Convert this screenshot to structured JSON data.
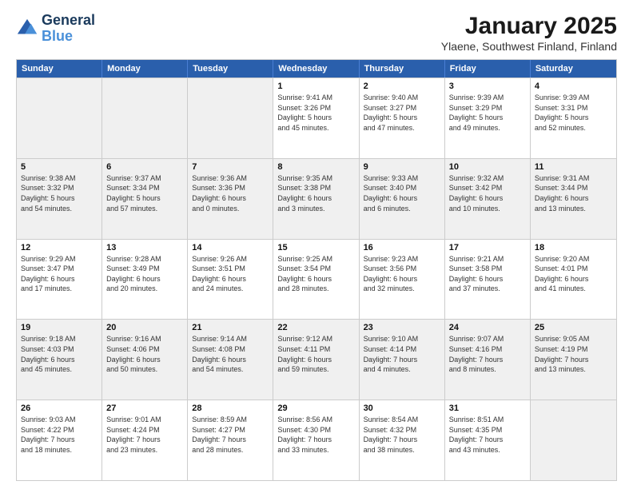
{
  "logo": {
    "line1": "General",
    "line2": "Blue"
  },
  "title": "January 2025",
  "subtitle": "Ylaene, Southwest Finland, Finland",
  "days": [
    "Sunday",
    "Monday",
    "Tuesday",
    "Wednesday",
    "Thursday",
    "Friday",
    "Saturday"
  ],
  "weeks": [
    [
      {
        "num": "",
        "info": ""
      },
      {
        "num": "",
        "info": ""
      },
      {
        "num": "",
        "info": ""
      },
      {
        "num": "1",
        "info": "Sunrise: 9:41 AM\nSunset: 3:26 PM\nDaylight: 5 hours\nand 45 minutes."
      },
      {
        "num": "2",
        "info": "Sunrise: 9:40 AM\nSunset: 3:27 PM\nDaylight: 5 hours\nand 47 minutes."
      },
      {
        "num": "3",
        "info": "Sunrise: 9:39 AM\nSunset: 3:29 PM\nDaylight: 5 hours\nand 49 minutes."
      },
      {
        "num": "4",
        "info": "Sunrise: 9:39 AM\nSunset: 3:31 PM\nDaylight: 5 hours\nand 52 minutes."
      }
    ],
    [
      {
        "num": "5",
        "info": "Sunrise: 9:38 AM\nSunset: 3:32 PM\nDaylight: 5 hours\nand 54 minutes."
      },
      {
        "num": "6",
        "info": "Sunrise: 9:37 AM\nSunset: 3:34 PM\nDaylight: 5 hours\nand 57 minutes."
      },
      {
        "num": "7",
        "info": "Sunrise: 9:36 AM\nSunset: 3:36 PM\nDaylight: 6 hours\nand 0 minutes."
      },
      {
        "num": "8",
        "info": "Sunrise: 9:35 AM\nSunset: 3:38 PM\nDaylight: 6 hours\nand 3 minutes."
      },
      {
        "num": "9",
        "info": "Sunrise: 9:33 AM\nSunset: 3:40 PM\nDaylight: 6 hours\nand 6 minutes."
      },
      {
        "num": "10",
        "info": "Sunrise: 9:32 AM\nSunset: 3:42 PM\nDaylight: 6 hours\nand 10 minutes."
      },
      {
        "num": "11",
        "info": "Sunrise: 9:31 AM\nSunset: 3:44 PM\nDaylight: 6 hours\nand 13 minutes."
      }
    ],
    [
      {
        "num": "12",
        "info": "Sunrise: 9:29 AM\nSunset: 3:47 PM\nDaylight: 6 hours\nand 17 minutes."
      },
      {
        "num": "13",
        "info": "Sunrise: 9:28 AM\nSunset: 3:49 PM\nDaylight: 6 hours\nand 20 minutes."
      },
      {
        "num": "14",
        "info": "Sunrise: 9:26 AM\nSunset: 3:51 PM\nDaylight: 6 hours\nand 24 minutes."
      },
      {
        "num": "15",
        "info": "Sunrise: 9:25 AM\nSunset: 3:54 PM\nDaylight: 6 hours\nand 28 minutes."
      },
      {
        "num": "16",
        "info": "Sunrise: 9:23 AM\nSunset: 3:56 PM\nDaylight: 6 hours\nand 32 minutes."
      },
      {
        "num": "17",
        "info": "Sunrise: 9:21 AM\nSunset: 3:58 PM\nDaylight: 6 hours\nand 37 minutes."
      },
      {
        "num": "18",
        "info": "Sunrise: 9:20 AM\nSunset: 4:01 PM\nDaylight: 6 hours\nand 41 minutes."
      }
    ],
    [
      {
        "num": "19",
        "info": "Sunrise: 9:18 AM\nSunset: 4:03 PM\nDaylight: 6 hours\nand 45 minutes."
      },
      {
        "num": "20",
        "info": "Sunrise: 9:16 AM\nSunset: 4:06 PM\nDaylight: 6 hours\nand 50 minutes."
      },
      {
        "num": "21",
        "info": "Sunrise: 9:14 AM\nSunset: 4:08 PM\nDaylight: 6 hours\nand 54 minutes."
      },
      {
        "num": "22",
        "info": "Sunrise: 9:12 AM\nSunset: 4:11 PM\nDaylight: 6 hours\nand 59 minutes."
      },
      {
        "num": "23",
        "info": "Sunrise: 9:10 AM\nSunset: 4:14 PM\nDaylight: 7 hours\nand 4 minutes."
      },
      {
        "num": "24",
        "info": "Sunrise: 9:07 AM\nSunset: 4:16 PM\nDaylight: 7 hours\nand 8 minutes."
      },
      {
        "num": "25",
        "info": "Sunrise: 9:05 AM\nSunset: 4:19 PM\nDaylight: 7 hours\nand 13 minutes."
      }
    ],
    [
      {
        "num": "26",
        "info": "Sunrise: 9:03 AM\nSunset: 4:22 PM\nDaylight: 7 hours\nand 18 minutes."
      },
      {
        "num": "27",
        "info": "Sunrise: 9:01 AM\nSunset: 4:24 PM\nDaylight: 7 hours\nand 23 minutes."
      },
      {
        "num": "28",
        "info": "Sunrise: 8:59 AM\nSunset: 4:27 PM\nDaylight: 7 hours\nand 28 minutes."
      },
      {
        "num": "29",
        "info": "Sunrise: 8:56 AM\nSunset: 4:30 PM\nDaylight: 7 hours\nand 33 minutes."
      },
      {
        "num": "30",
        "info": "Sunrise: 8:54 AM\nSunset: 4:32 PM\nDaylight: 7 hours\nand 38 minutes."
      },
      {
        "num": "31",
        "info": "Sunrise: 8:51 AM\nSunset: 4:35 PM\nDaylight: 7 hours\nand 43 minutes."
      },
      {
        "num": "",
        "info": ""
      }
    ]
  ]
}
